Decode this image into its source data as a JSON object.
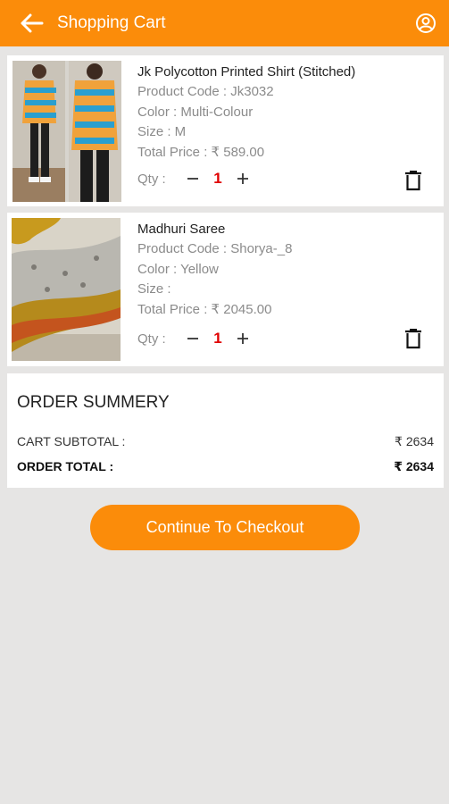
{
  "header": {
    "title": "Shopping Cart",
    "back_icon": "arrow-left-icon",
    "profile_icon": "user-circle-icon"
  },
  "colors": {
    "accent": "#fb8c0a",
    "qty": "#e00000",
    "background": "#e6e5e4"
  },
  "items": [
    {
      "name": "Jk Polycotton Printed Shirt  (Stitched)",
      "code": "Product Code : Jk3032",
      "color": "Color : Multi-Colour",
      "size": "Size : M",
      "price": "Total Price : ₹ 589.00",
      "qty_label": "Qty :",
      "qty": "1"
    },
    {
      "name": "Madhuri Saree",
      "code": "Product Code : Shorya-_8",
      "color": "Color : Yellow",
      "size": "Size :",
      "price": "Total Price : ₹ 2045.00",
      "qty_label": "Qty :",
      "qty": "1"
    }
  ],
  "summary": {
    "title": "ORDER SUMMERY",
    "subtotal_label": "CART SUBTOTAL  :",
    "subtotal_value": "₹ 2634",
    "total_label": "ORDER TOTAL :",
    "total_value": "₹ 2634"
  },
  "checkout_label": "Continue To Checkout"
}
